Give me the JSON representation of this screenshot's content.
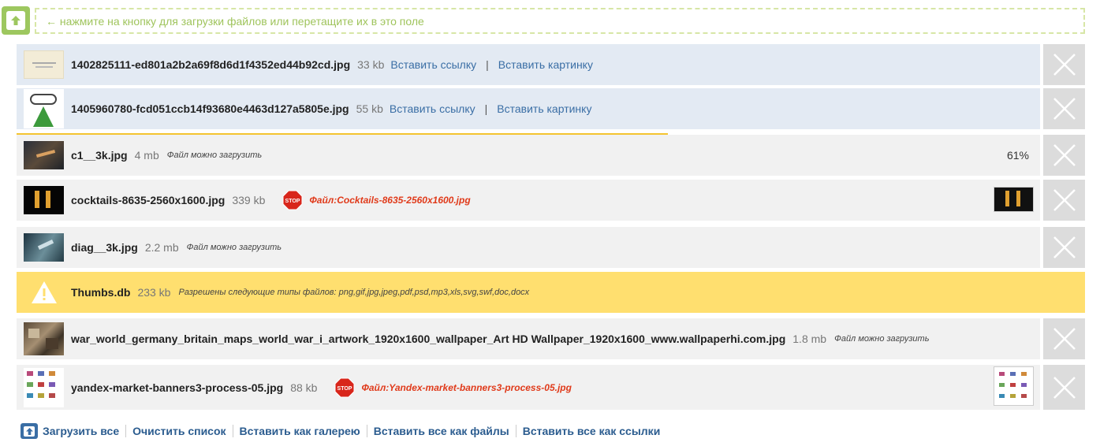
{
  "dropzone": {
    "hint": "← нажмите на кнопку для загрузки файлов или перетащите их в это поле"
  },
  "files": [
    {
      "name": "1402825111-ed801a2b2a69f8d6d1f4352ed44b92cd.jpg",
      "size": "33 kb",
      "insert_link": "Вставить ссылку",
      "separator": "|",
      "insert_image": "Вставить картинку"
    },
    {
      "name": "1405960780-fcd051ccb14f93680e4463d127a5805e.jpg",
      "size": "55 kb",
      "insert_link": "Вставить ссылку",
      "separator": "|",
      "insert_image": "Вставить картинку"
    },
    {
      "name": "c1__3k.jpg",
      "size": "4 mb",
      "note": "Файл можно загрузить",
      "progress_text": "61%",
      "progress": 0.61
    },
    {
      "name": "cocktails-8635-2560x1600.jpg",
      "size": "339 kb",
      "error": "Файл:Cocktails-8635-2560x1600.jpg",
      "stop_label": "STOP"
    },
    {
      "name": "diag__3k.jpg",
      "size": "2.2 mb",
      "note": "Файл можно загрузить"
    },
    {
      "name": "Thumbs.db",
      "size": "233 kb",
      "note": "Разрешены следующие типы файлов: png,gif,jpg,jpeg,pdf,psd,mp3,xls,svg,swf,doc,docx"
    },
    {
      "name": "war_world_germany_britain_maps_world_war_i_artwork_1920x1600_wallpaper_Art HD Wallpaper_1920x1600_www.wallpaperhi.com.jpg",
      "size": "1.8 mb",
      "note": "Файл можно загрузить"
    },
    {
      "name": "yandex-market-banners3-process-05.jpg",
      "size": "88 kb",
      "error": "Файл:Yandex-market-banners3-process-05.jpg",
      "stop_label": "STOP"
    }
  ],
  "footer": {
    "upload_all": "Загрузить все",
    "clear_list": "Очистить список",
    "insert_gallery": "Вставить как галерею",
    "insert_all_files": "Вставить все как файлы",
    "insert_all_links": "Вставить все как ссылки"
  },
  "colors": {
    "accent_green": "#9dc75f",
    "link_blue": "#3a6ea5",
    "warning_yellow": "#ffdf6f",
    "progress_yellow": "#f4c430",
    "error_red": "#e03a1a"
  },
  "icons": {
    "upload": "upload-arrow-icon",
    "close": "close-x-icon",
    "warning": "warning-triangle-icon",
    "stop": "stop-sign-icon"
  }
}
